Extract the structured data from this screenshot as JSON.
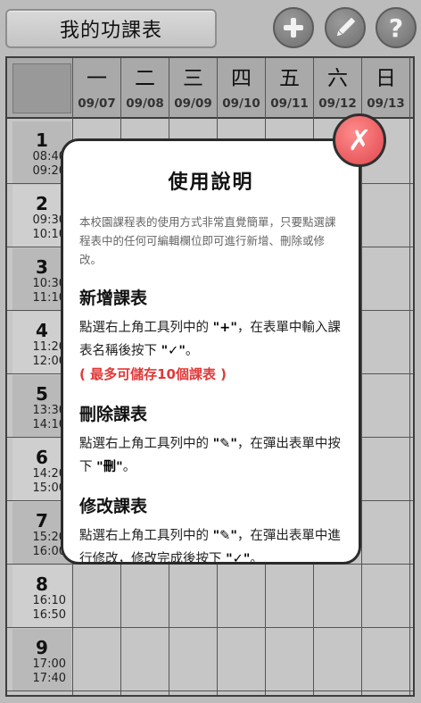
{
  "app": {
    "title": "我的功課表"
  },
  "toolbar": {
    "add_icon": "plus-icon",
    "edit_icon": "pencil-icon",
    "help_icon": "question-icon"
  },
  "schedule": {
    "days": [
      {
        "name": "一",
        "date": "09/07"
      },
      {
        "name": "二",
        "date": "09/08"
      },
      {
        "name": "三",
        "date": "09/09"
      },
      {
        "name": "四",
        "date": "09/10"
      },
      {
        "name": "五",
        "date": "09/11"
      },
      {
        "name": "六",
        "date": "09/12"
      },
      {
        "name": "日",
        "date": "09/13"
      }
    ],
    "periods": [
      {
        "num": "1",
        "start": "08:40",
        "end": "09:20"
      },
      {
        "num": "2",
        "start": "09:30",
        "end": "10:10"
      },
      {
        "num": "3",
        "start": "10:30",
        "end": "11:10"
      },
      {
        "num": "4",
        "start": "11:20",
        "end": "12:00"
      },
      {
        "num": "5",
        "start": "13:30",
        "end": "14:10"
      },
      {
        "num": "6",
        "start": "14:20",
        "end": "15:00"
      },
      {
        "num": "7",
        "start": "15:20",
        "end": "16:00"
      },
      {
        "num": "8",
        "start": "16:10",
        "end": "16:50"
      },
      {
        "num": "9",
        "start": "17:00",
        "end": "17:40"
      }
    ]
  },
  "help": {
    "title": "使用說明",
    "intro": "本校園課程表的使用方式非常直覺簡單，只要點選課程表中的任何可編輯欄位即可進行新增、刪除或修改。",
    "close_label": "✗",
    "sections": [
      {
        "title": "新增課表",
        "line1a": "點選右上角工具列中的 ",
        "line1sym": "\"+\"",
        "line1b": "，在表單中輸入課表名稱後按下 ",
        "line1sym2": "\"✓\"",
        "line1c": "。",
        "warn": "( 最多可儲存10個課表 )"
      },
      {
        "title": "刪除課表",
        "line1a": "點選右上角工具列中的 ",
        "line1sym": "\"✎\"",
        "line1b": "，在彈出表單中按下 ",
        "line1sym2": "\"刪\"",
        "line1c": "。"
      },
      {
        "title": "修改課表",
        "line1a": "點選右上角工具列中的 ",
        "line1sym": "\"✎\"",
        "line1b": "，在彈出表單中進行修改，修改完成後按下 ",
        "line1sym2": "\"✓\"",
        "line1c": "。"
      }
    ]
  }
}
